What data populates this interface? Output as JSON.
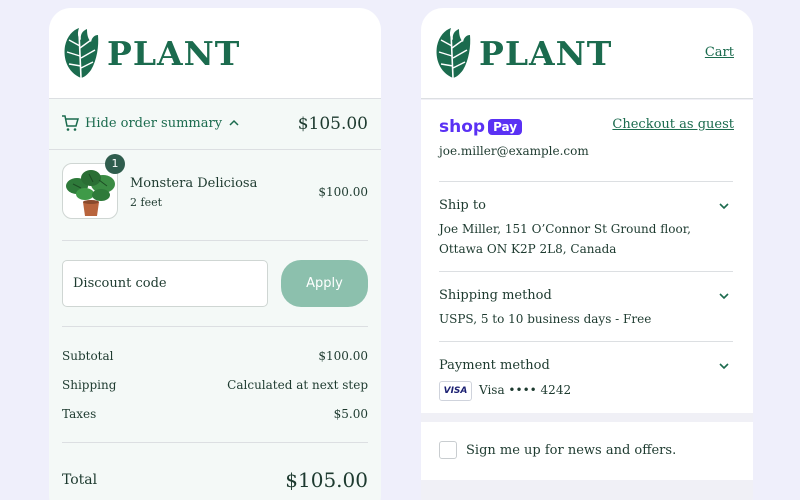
{
  "brand": {
    "name": "PLANT",
    "color": "#1b6b4e"
  },
  "order_summary": {
    "toggle_label": "Hide order summary",
    "total": "$105.00",
    "item": {
      "quantity": "1",
      "name": "Monstera Deliciosa",
      "variant": "2 feet",
      "price": "$100.00"
    },
    "discount": {
      "placeholder": "Discount code",
      "apply_label": "Apply"
    },
    "lines": [
      {
        "label": "Subtotal",
        "value": "$100.00"
      },
      {
        "label": "Shipping",
        "value": "Calculated at next step"
      },
      {
        "label": "Taxes",
        "value": "$5.00"
      }
    ],
    "grand_total": {
      "label": "Total",
      "value": "$105.00"
    }
  },
  "checkout": {
    "cart_link": "Cart",
    "shop_pay": {
      "shop": "shop",
      "pay": "Pay"
    },
    "guest_link": "Checkout as guest",
    "email": "joe.miller@example.com",
    "ship_to": {
      "title": "Ship to",
      "line1": "Joe Miller, 151 O’Connor St Ground floor,",
      "line2": "Ottawa ON K2P 2L8, Canada"
    },
    "shipping_method": {
      "title": "Shipping method",
      "value": "USPS, 5 to 10 business days - Free"
    },
    "payment_method": {
      "title": "Payment method",
      "card_brand": "VISA",
      "card": "Visa •••• 4242"
    },
    "newsletter": {
      "label": "Sign me up for news and offers.",
      "checked": false
    }
  }
}
